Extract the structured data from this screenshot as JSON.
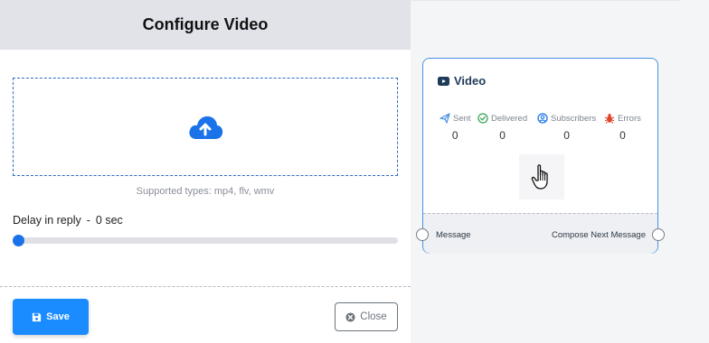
{
  "panel": {
    "title": "Configure Video",
    "supported_types": "Supported types: mp4, flv, wmv",
    "delay": {
      "label": "Delay in reply",
      "separator": "-",
      "value": "0 sec",
      "slider_value": 0
    },
    "save_label": "Save",
    "close_label": "Close",
    "icons": {
      "upload": "cloud-upload-icon",
      "save": "floppy-disk-icon",
      "close": "times-circle-icon"
    },
    "colors": {
      "accent": "#1a8cff",
      "upload_icon": "#1a73e8"
    }
  },
  "node": {
    "title": "Video",
    "icon": "youtube-icon",
    "stats": [
      {
        "label": "Sent",
        "value": "0",
        "icon": "paper-plane-icon",
        "color": "#4a90e2"
      },
      {
        "label": "Delivered",
        "value": "0",
        "icon": "check-circle-icon",
        "color": "#3aa655"
      },
      {
        "label": "Subscribers",
        "value": "0",
        "icon": "user-circle-icon",
        "color": "#1a73e8"
      },
      {
        "label": "Errors",
        "value": "0",
        "icon": "bug-icon",
        "color": "#e0452c"
      }
    ],
    "ports": {
      "left_label": "Message",
      "right_label": "Compose Next Message"
    },
    "hand_icon": "hand-pointer-icon"
  }
}
